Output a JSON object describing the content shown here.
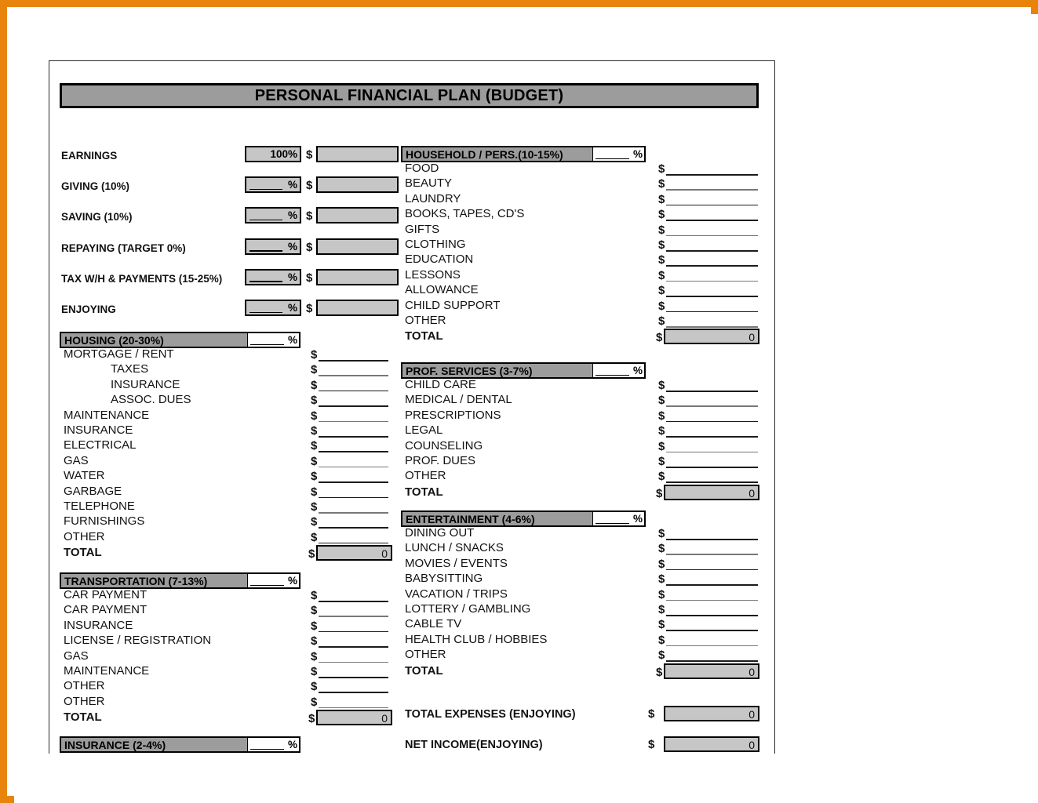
{
  "frame": {
    "border_color": "#e8840c"
  },
  "document": {
    "title": "PERSONAL FINANCIAL PLAN (BUDGET)"
  },
  "earnings": {
    "dollar_symbol": "$",
    "rows": [
      {
        "label": "EARNINGS",
        "percent": "100%",
        "percent_filled": true
      },
      {
        "label": "GIVING (10%)",
        "percent": "%",
        "percent_filled": false
      },
      {
        "label": "SAVING (10%)",
        "percent": "%",
        "percent_filled": false
      },
      {
        "label": "REPAYING (TARGET 0%)",
        "percent": "%",
        "percent_filled": false
      },
      {
        "label": "TAX W/H & PAYMENTS (15-25%)",
        "percent": "%",
        "percent_filled": false
      },
      {
        "label": "ENJOYING",
        "percent": "%",
        "percent_filled": false
      }
    ]
  },
  "sections": {
    "housing": {
      "header": "HOUSING (20-30%)",
      "percent": "%",
      "items": [
        {
          "label": "MORTGAGE / RENT",
          "indent": 0
        },
        {
          "label": "TAXES",
          "indent": 1
        },
        {
          "label": "INSURANCE",
          "indent": 1
        },
        {
          "label": "ASSOC. DUES",
          "indent": 1
        },
        {
          "label": "MAINTENANCE",
          "indent": 0
        },
        {
          "label": "INSURANCE",
          "indent": 0
        },
        {
          "label": "ELECTRICAL",
          "indent": 0
        },
        {
          "label": "GAS",
          "indent": 0
        },
        {
          "label": "WATER",
          "indent": 0
        },
        {
          "label": "GARBAGE",
          "indent": 0
        },
        {
          "label": "TELEPHONE",
          "indent": 0
        },
        {
          "label": "FURNISHINGS",
          "indent": 0
        },
        {
          "label": "OTHER",
          "indent": 0
        }
      ],
      "total_label": "TOTAL",
      "total_value": "0"
    },
    "transportation": {
      "header": "TRANSPORTATION (7-13%)",
      "percent": "%",
      "items": [
        {
          "label": "CAR PAYMENT",
          "indent": 0
        },
        {
          "label": "CAR PAYMENT",
          "indent": 0
        },
        {
          "label": "INSURANCE",
          "indent": 0
        },
        {
          "label": "LICENSE / REGISTRATION",
          "indent": 0
        },
        {
          "label": "GAS",
          "indent": 0
        },
        {
          "label": "MAINTENANCE",
          "indent": 0
        },
        {
          "label": "OTHER",
          "indent": 0
        },
        {
          "label": "OTHER",
          "indent": 0
        }
      ],
      "total_label": "TOTAL",
      "total_value": "0"
    },
    "insurance": {
      "header": "INSURANCE (2-4%)",
      "percent": "%",
      "items": [],
      "total_label": "",
      "total_value": ""
    },
    "household": {
      "header": "HOUSEHOLD / PERS.(10-15%)",
      "percent": "%",
      "items": [
        {
          "label": "FOOD",
          "indent": 0
        },
        {
          "label": "BEAUTY",
          "indent": 0
        },
        {
          "label": "LAUNDRY",
          "indent": 0
        },
        {
          "label": "BOOKS, TAPES, CD'S",
          "indent": 0
        },
        {
          "label": "GIFTS",
          "indent": 0
        },
        {
          "label": "CLOTHING",
          "indent": 0
        },
        {
          "label": "EDUCATION",
          "indent": 0
        },
        {
          "label": "LESSONS",
          "indent": 0
        },
        {
          "label": "ALLOWANCE",
          "indent": 0
        },
        {
          "label": "CHILD SUPPORT",
          "indent": 0
        },
        {
          "label": "OTHER",
          "indent": 0
        }
      ],
      "total_label": "TOTAL",
      "total_value": "0"
    },
    "prof_services": {
      "header": "PROF. SERVICES (3-7%)",
      "percent": "%",
      "items": [
        {
          "label": "CHILD CARE",
          "indent": 0
        },
        {
          "label": "MEDICAL / DENTAL",
          "indent": 0
        },
        {
          "label": "PRESCRIPTIONS",
          "indent": 0
        },
        {
          "label": "LEGAL",
          "indent": 0
        },
        {
          "label": "COUNSELING",
          "indent": 0
        },
        {
          "label": "PROF. DUES",
          "indent": 0
        },
        {
          "label": "OTHER",
          "indent": 0
        }
      ],
      "total_label": "TOTAL",
      "total_value": "0"
    },
    "entertainment": {
      "header": "ENTERTAINMENT (4-6%)",
      "percent": "%",
      "items": [
        {
          "label": "DINING OUT",
          "indent": 0
        },
        {
          "label": "LUNCH / SNACKS",
          "indent": 0
        },
        {
          "label": "MOVIES / EVENTS",
          "indent": 0
        },
        {
          "label": "BABYSITTING",
          "indent": 0
        },
        {
          "label": "VACATION / TRIPS",
          "indent": 0
        },
        {
          "label": "LOTTERY / GAMBLING",
          "indent": 0
        },
        {
          "label": "CABLE TV",
          "indent": 0
        },
        {
          "label": "HEALTH CLUB / HOBBIES",
          "indent": 0
        },
        {
          "label": "OTHER",
          "indent": 0
        }
      ],
      "total_label": "TOTAL",
      "total_value": "0"
    }
  },
  "summary": {
    "total_expenses_label": "TOTAL EXPENSES (ENJOYING)",
    "total_expenses_value": "0",
    "net_income_label": "NET INCOME(ENJOYING)",
    "net_income_value": "0",
    "dollar_symbol": "$"
  },
  "colors": {
    "section_header_gray": "#9c9c9c",
    "field_gray": "#c6c6c6",
    "frame_orange": "#e8840c"
  }
}
